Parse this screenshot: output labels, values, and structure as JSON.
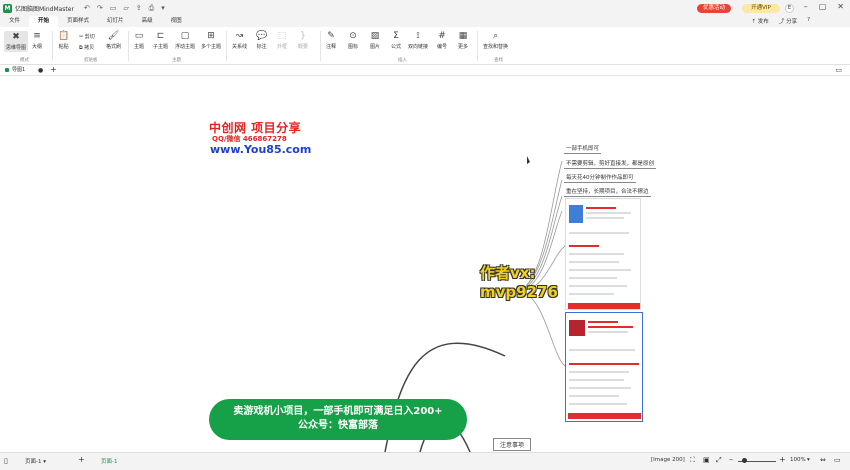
{
  "app": {
    "title": "亿图脑图MindMaster",
    "logo": "M"
  },
  "titlebar": {
    "promo": "优惠活动",
    "vip": "开通VIP",
    "avatar": "E"
  },
  "menu": [
    "文件",
    "开始",
    "页面样式",
    "幻灯片",
    "高级",
    "视图"
  ],
  "menu_active_index": 1,
  "header_right": {
    "publish": "发布",
    "share": "分享"
  },
  "ribbon": {
    "mindmap": "思维导图",
    "outline": "大纲",
    "paste": "粘贴",
    "cut": "剪切",
    "copy": "拷贝",
    "format_painter": "格式刷",
    "topic": "主题",
    "subtopic": "子主题",
    "floating": "浮动主题",
    "multi": "多个主题",
    "relation": "关系线",
    "callout": "标注",
    "summary": "外框",
    "boundary": "概要",
    "note": "注释",
    "icon": "图标",
    "image": "图片",
    "formula": "公式",
    "hyperlink": "双向链接",
    "number": "编号",
    "more": "更多",
    "find_replace": "查找和替换",
    "groups": {
      "mode": "模式",
      "clipboard": "剪贴板",
      "topic": "主题",
      "insert": "插入",
      "find": "查找"
    }
  },
  "tabs": [
    {
      "label": "导图1"
    }
  ],
  "watermarks": {
    "site": "中创网 项目分享",
    "qq": "QQ/微信 466867278",
    "url": "www.You85.com",
    "author_line1": "作者vx:",
    "author_line2": "mvp9276"
  },
  "topics": [
    "一部手机即可",
    "不需要剪辑，剪好直接发，都是原创",
    "每天花40分钟制作作品即可",
    "重在坚持，长期项目，合法不擦边"
  ],
  "banner": {
    "line1": "卖游戏机小项目，一部手机即可满足日入200+",
    "line2": "公众号：快富部落"
  },
  "bottom_node": "注意事项",
  "status": {
    "page": "页面-1",
    "add": "+",
    "active_page": "页面-1",
    "image_info": "[Image 200]",
    "zoom": "100%"
  }
}
